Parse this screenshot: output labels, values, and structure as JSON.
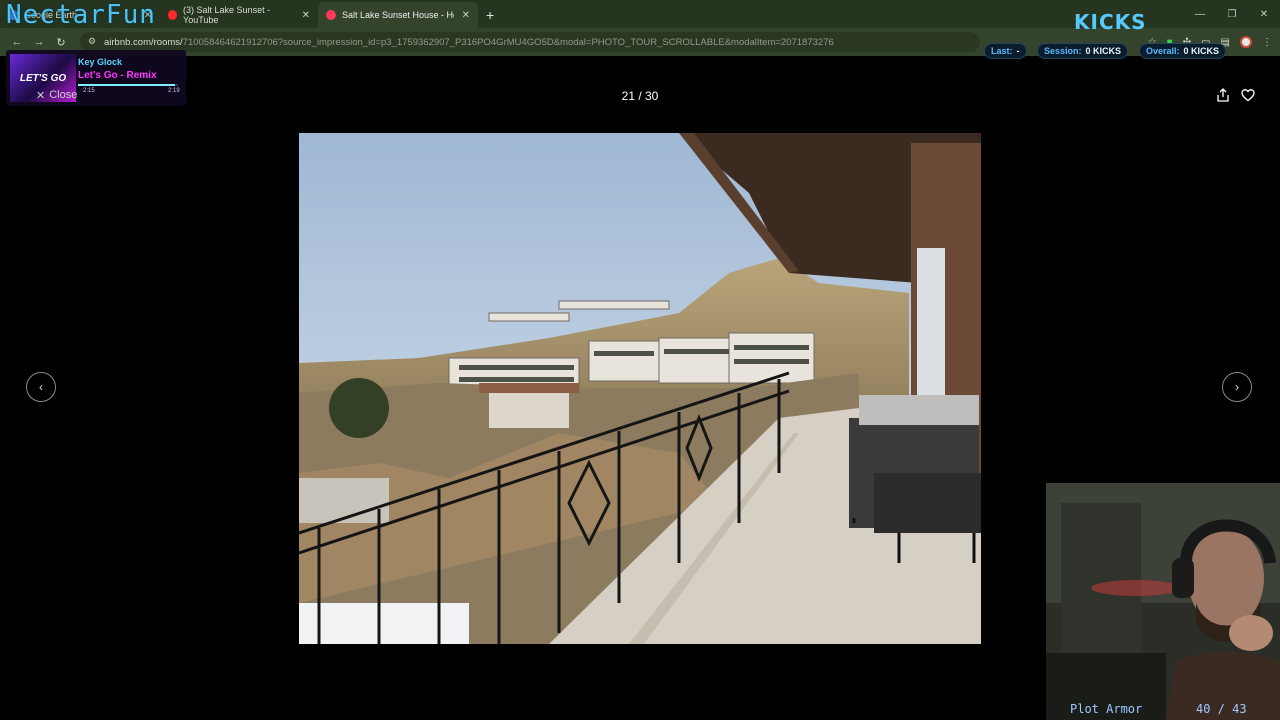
{
  "browser": {
    "tabs": [
      {
        "label": "Google Earth",
        "favicon_color": "#4a8af4"
      },
      {
        "label": "(3) Salt Lake Sunset - YouTube",
        "favicon_color": "#ff2a2a"
      },
      {
        "label": "Salt Lake Sunset House - Houses",
        "favicon_color": "#ff385c"
      }
    ],
    "new_tab": "+",
    "url_host": "airbnb.com/rooms/",
    "url_rest": "710058464621912706?source_impression_id=p3_1759362907_P316PO4GrMU4GO5D&modal=PHOTO_TOUR_SCROLLABLE&modalItem=2071873276"
  },
  "overlay": {
    "brand": "NectarFun",
    "now_playing": {
      "album_text": "LET'S GO",
      "artist": "Key Glock",
      "title": "Let's Go - Remix",
      "elapsed": "2:15",
      "total": "2:19",
      "progress": 0.97
    },
    "kicks": {
      "title": "KICKS",
      "last_label": "Last:",
      "last_value": "-",
      "session_label": "Session:",
      "session_value": "0 KICKS",
      "overall_label": "Overall:",
      "overall_value": "0 KICKS"
    },
    "webcam": {
      "name": "Plot Armor",
      "score": "40 / 43"
    }
  },
  "page": {
    "close_label": "Close",
    "counter": "21 / 30"
  },
  "colors": {
    "browser_frame": "#26351f",
    "brand_cyan": "#4ec3f2",
    "kicks_blue": "#58c9ff",
    "now_playing_pink": "#ff36ff"
  }
}
